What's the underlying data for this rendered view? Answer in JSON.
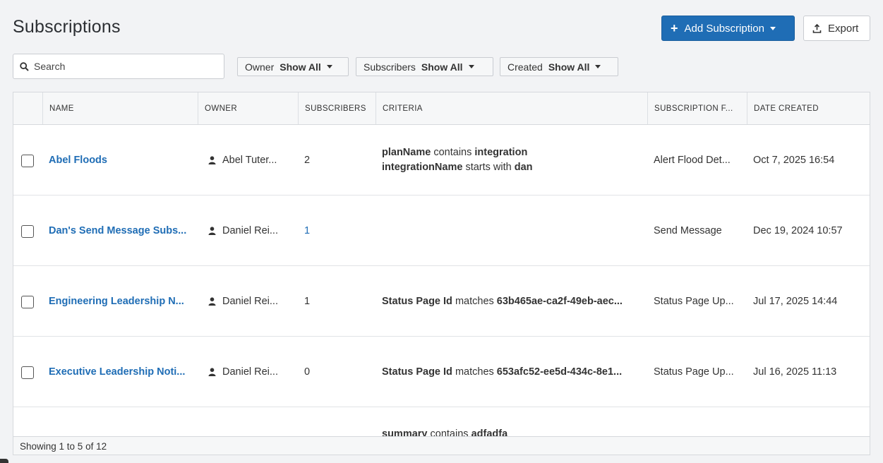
{
  "page": {
    "title": "Subscriptions"
  },
  "toolbar": {
    "add_label": "Add Subscription",
    "export_label": "Export"
  },
  "search": {
    "placeholder": "Search",
    "value": ""
  },
  "filters": [
    {
      "label": "Owner",
      "value": "Show All"
    },
    {
      "label": "Subscribers",
      "value": "Show All"
    },
    {
      "label": "Created",
      "value": "Show All"
    }
  ],
  "table": {
    "columns": [
      "NAME",
      "OWNER",
      "SUBSCRIBERS",
      "CRITERIA",
      "SUBSCRIPTION F...",
      "DATE CREATED"
    ],
    "rows": [
      {
        "name": "Abel Floods",
        "owner": "Abel Tuter...",
        "subscribers": "2",
        "criteria": [
          {
            "field": "planName",
            "op": "contains",
            "value": "integration"
          },
          {
            "field": "integrationName",
            "op": "starts with",
            "value": "dan"
          }
        ],
        "form": "Alert Flood Det...",
        "date": "Oct 7, 2025 16:54"
      },
      {
        "name": "Dan's Send Message Subs...",
        "owner": "Daniel Rei...",
        "subscribers": "1",
        "criteria": [],
        "form": "Send Message",
        "date": "Dec 19, 2024 10:57"
      },
      {
        "name": "Engineering Leadership N...",
        "owner": "Daniel Rei...",
        "subscribers": "1",
        "criteria": [
          {
            "field": "Status Page Id",
            "op": "matches",
            "value": "63b465ae-ca2f-49eb-aec..."
          }
        ],
        "form": "Status Page Up...",
        "date": "Jul 17, 2025 14:44"
      },
      {
        "name": "Executive Leadership Noti...",
        "owner": "Daniel Rei...",
        "subscribers": "0",
        "criteria": [
          {
            "field": "Status Page Id",
            "op": "matches",
            "value": "653afc52-ee5d-434c-8e1..."
          }
        ],
        "form": "Status Page Up...",
        "date": "Jul 16, 2025 11:13"
      }
    ],
    "partial_row": {
      "field": "summary",
      "op": "contains",
      "value": "adfadfa"
    }
  },
  "footer": {
    "text": "Showing 1 to 5 of 12"
  },
  "colors": {
    "primary": "#1f6db5",
    "background": "#f2f3f5",
    "text": "#333333"
  }
}
